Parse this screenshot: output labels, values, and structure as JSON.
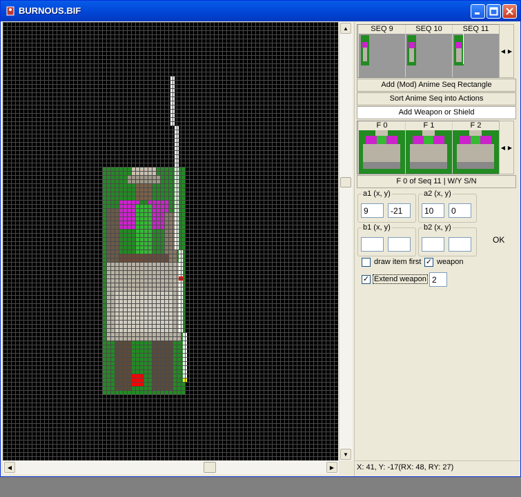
{
  "window": {
    "title": "BURNOUS.BIF"
  },
  "sequences": {
    "labels": [
      "SEQ 9",
      "SEQ 10",
      "SEQ 11"
    ]
  },
  "buttons": {
    "add_mod_rect": "Add (Mod) Anime Seq Rectangle",
    "sort_actions": "Sort  Anime Seq into Actions",
    "add_weapon": "Add Weapon or Shield",
    "frame_info": "F 0 of Seq 11 | W/Y S/N",
    "ok": "OK"
  },
  "frames": {
    "labels": [
      "F 0",
      "F 1",
      "F 2"
    ]
  },
  "groups": {
    "a1": {
      "title": "a1 (x, y)",
      "x": "9",
      "y": "-21"
    },
    "a2": {
      "title": "a2 (x, y)",
      "x": "10",
      "y": "0"
    },
    "b1": {
      "title": "b1 (x, y)",
      "x": "",
      "y": ""
    },
    "b2": {
      "title": "b2 (x, y)",
      "x": "",
      "y": ""
    }
  },
  "options": {
    "draw_item_first": {
      "label": "draw item first",
      "checked": false
    },
    "weapon": {
      "label": "weapon",
      "checked": true
    },
    "extend_weapon": {
      "label": "Extend weapon",
      "checked": true,
      "value": "2"
    }
  },
  "status": {
    "text": "X: 41, Y: -17(RX: 48, RY: 27)"
  },
  "colors": {
    "title_bar": "#0554e3",
    "grid_line": "#4a4a4a",
    "sprite_bg": "#228b22",
    "magenta": "#cc22cc",
    "weapon": "#ffffff",
    "marker_red": "#ff0000",
    "marker_yellow": "#ffff00"
  }
}
